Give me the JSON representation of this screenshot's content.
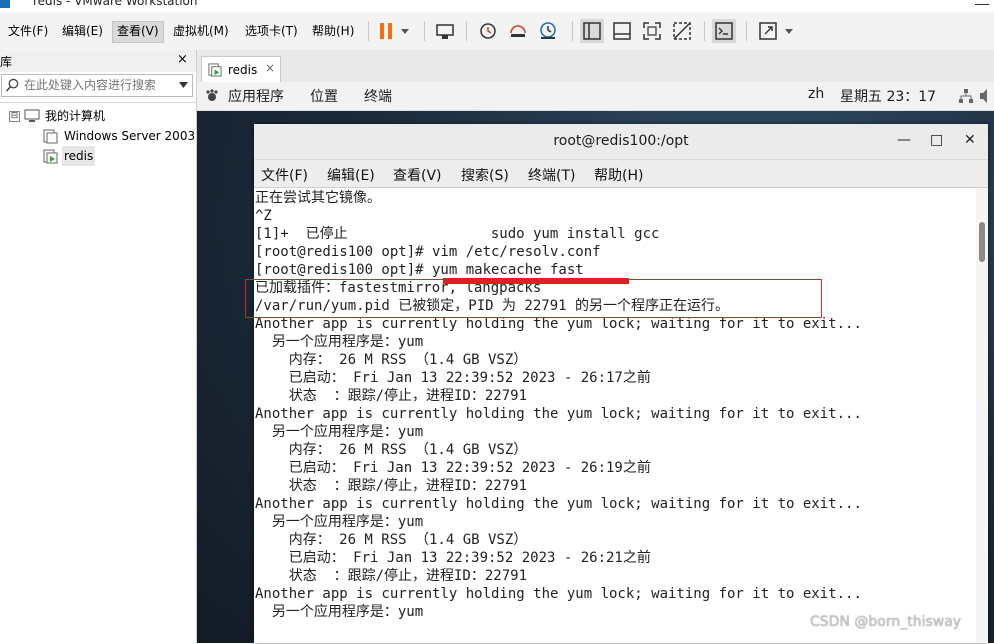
{
  "window": {
    "title": "redis - VMware Workstation"
  },
  "menubar": {
    "items": [
      {
        "label": "文件(F)"
      },
      {
        "label": "编辑(E)"
      },
      {
        "label": "查看(V)"
      },
      {
        "label": "虚拟机(M)"
      },
      {
        "label": "选项卡(T)"
      },
      {
        "label": "帮助(H)"
      }
    ],
    "active_item": "查看(V)"
  },
  "toolbar": {
    "icons": [
      "pause-icon",
      "dropdown-icon",
      "send-keys-icon",
      "snapshot-icon",
      "revert-snapshot-icon",
      "snapshot-manager-icon",
      "show-library-icon",
      "thumbnail-bar-icon",
      "fullscreen-icon",
      "unity-icon",
      "console-view-icon",
      "stretch-icon"
    ],
    "colors": {
      "pause": "#f07010",
      "accent": "#1b6fb5"
    }
  },
  "library": {
    "title": "库",
    "close": "×",
    "search_placeholder": "在此处键入内容进行搜索",
    "tree": {
      "root": "我的计算机",
      "toggle": "⊟",
      "items": [
        {
          "label": "Windows Server 2003"
        },
        {
          "label": "redis"
        }
      ]
    }
  },
  "vm_tab": {
    "label": "redis",
    "close": "×"
  },
  "gnome_bar": {
    "applications": "应用程序",
    "places": "位置",
    "terminal": "终端",
    "lang": "zh",
    "clock": "星期五 23：17"
  },
  "terminal": {
    "title": "root@redis100:/opt",
    "controls": {
      "minimize": "—",
      "maximize": "□",
      "close": "✕"
    },
    "menu": [
      {
        "label": "文件(F)"
      },
      {
        "label": "编辑(E)"
      },
      {
        "label": "查看(V)"
      },
      {
        "label": "搜索(S)"
      },
      {
        "label": "终端(T)"
      },
      {
        "label": "帮助(H)"
      }
    ],
    "lines": [
      "正在尝试其它镜像。",
      "^Z",
      "[1]+  已停止                 sudo yum install gcc",
      "[root@redis100 opt]# vim /etc/resolv.conf",
      "[root@redis100 opt]# yum makecache fast",
      "已加载插件：fastestmirror, langpacks",
      "/var/run/yum.pid 已被锁定，PID 为 22791 的另一个程序正在运行。",
      "Another app is currently holding the yum lock; waiting for it to exit...",
      "  另一个应用程序是：yum",
      "    内存： 26 M RSS （1.4 GB VSZ）",
      "    已启动： Fri Jan 13 22:39:52 2023 - 26:17之前",
      "    状态  ：跟踪/停止，进程ID：22791",
      "Another app is currently holding the yum lock; waiting for it to exit...",
      "  另一个应用程序是：yum",
      "    内存： 26 M RSS （1.4 GB VSZ）",
      "    已启动： Fri Jan 13 22:39:52 2023 - 26:19之前",
      "    状态  ：跟踪/停止，进程ID：22791",
      "Another app is currently holding the yum lock; waiting for it to exit...",
      "  另一个应用程序是：yum",
      "    内存： 26 M RSS （1.4 GB VSZ）",
      "    已启动： Fri Jan 13 22:39:52 2023 - 26:21之前",
      "    状态  ：跟踪/停止，进程ID：22791",
      "Another app is currently holding the yum lock; waiting for it to exit...",
      "  另一个应用程序是：yum"
    ]
  },
  "annotation": {
    "color": "#e02020"
  },
  "watermark": "CSDN @born_thisway"
}
